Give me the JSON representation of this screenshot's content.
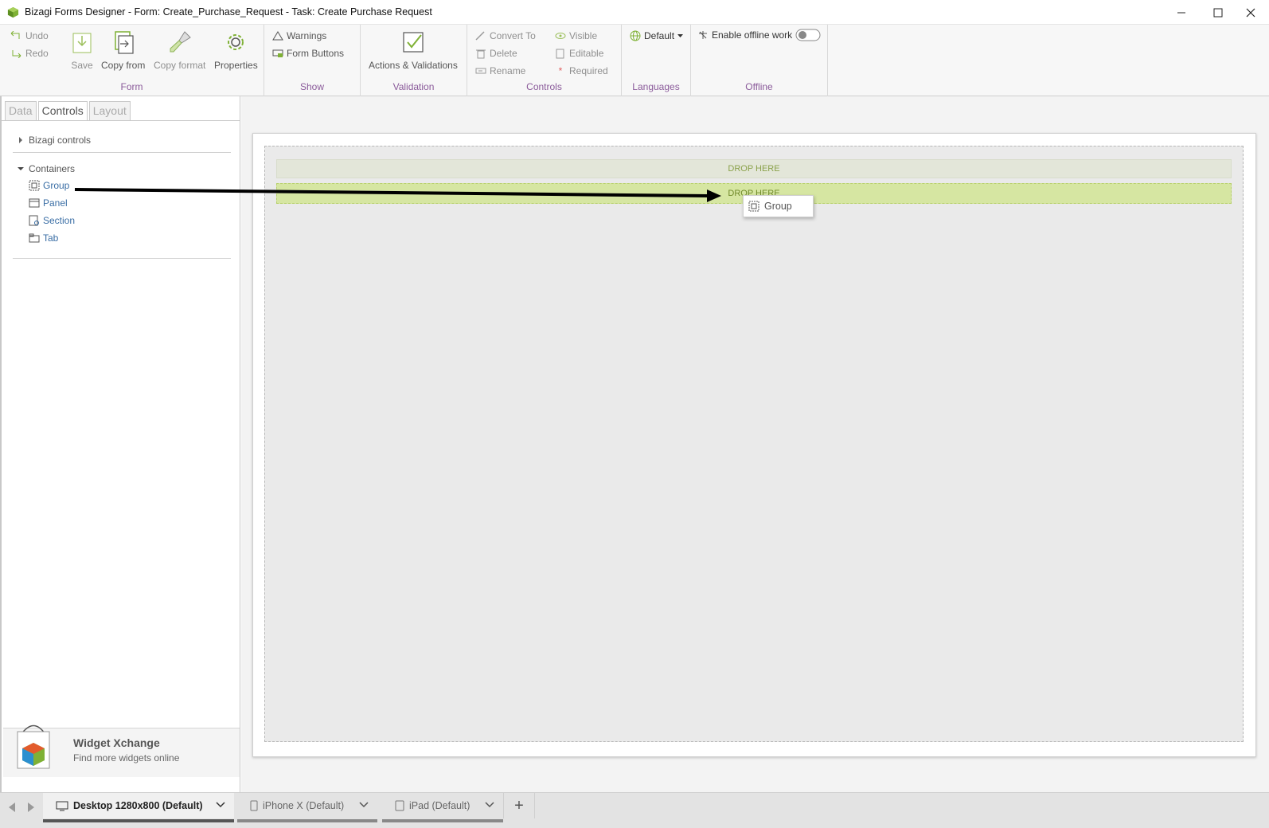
{
  "window": {
    "title": "Bizagi Forms Designer  - Form: Create_Purchase_Request - Task:  Create Purchase Request",
    "accent": "#8a5a9a",
    "brand_green": "#7fb135"
  },
  "ribbon": {
    "undo": "Undo",
    "redo": "Redo",
    "save": "Save",
    "copy_from": "Copy from",
    "copy_format": "Copy format",
    "properties": "Properties",
    "warnings": "Warnings",
    "form_buttons": "Form Buttons",
    "actions_validations": "Actions & Validations",
    "convert_to": "Convert To",
    "delete": "Delete",
    "rename": "Rename",
    "visible": "Visible",
    "editable": "Editable",
    "required": "Required",
    "language": "Default",
    "offline": "Enable offline work",
    "groups": {
      "form": "Form",
      "show": "Show",
      "validation": "Validation",
      "controls": "Controls",
      "languages": "Languages",
      "offline": "Offline"
    }
  },
  "left_panel": {
    "tabs": [
      "Data",
      "Controls",
      "Layout"
    ],
    "active_tab": "Controls",
    "bizagi_controls": "Bizagi controls",
    "containers": "Containers",
    "container_items": [
      "Group",
      "Panel",
      "Section",
      "Tab"
    ],
    "widget": {
      "title": "Widget Xchange",
      "subtitle": "Find more widgets online"
    }
  },
  "canvas": {
    "drop_here_1": "DROP HERE",
    "drop_here_2": "DROP HERE",
    "drag_item": "Group"
  },
  "bottom": {
    "devices": [
      {
        "label": "Desktop 1280x800 (Default)",
        "icon": "desktop-icon"
      },
      {
        "label": "iPhone X (Default)",
        "icon": "phone-icon"
      },
      {
        "label": "iPad (Default)",
        "icon": "tablet-icon"
      }
    ],
    "add": "+"
  }
}
